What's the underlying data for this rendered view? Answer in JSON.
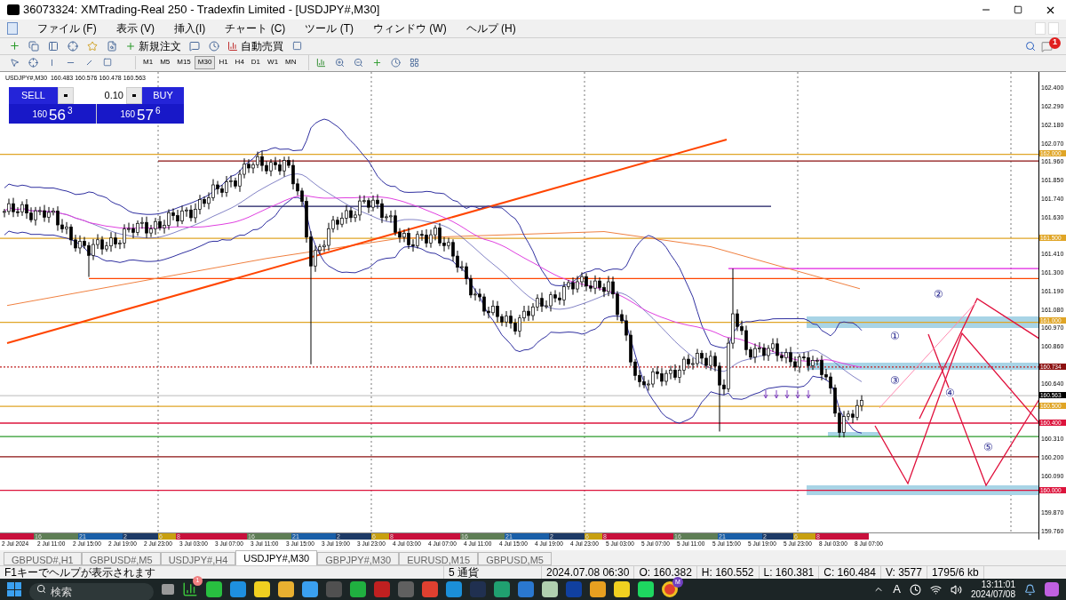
{
  "window": {
    "title": "36073324: XMTrading-Real 250 - Tradexfin Limited - [USDJPY#,M30]"
  },
  "menu": [
    "ファイル (F)",
    "表示 (V)",
    "挿入(I)",
    "チャート (C)",
    "ツール (T)",
    "ウィンドウ (W)",
    "ヘルプ (H)"
  ],
  "toolbar": {
    "new_order": "新規注文",
    "auto_trading": "自動売買",
    "notification_count": "1"
  },
  "timeframes": [
    {
      "label": "M1",
      "selected": false
    },
    {
      "label": "M5",
      "selected": false
    },
    {
      "label": "M15",
      "selected": false
    },
    {
      "label": "M30",
      "selected": true
    },
    {
      "label": "H1",
      "selected": false
    },
    {
      "label": "H4",
      "selected": false
    },
    {
      "label": "D1",
      "selected": false
    },
    {
      "label": "W1",
      "selected": false
    },
    {
      "label": "MN",
      "selected": false
    }
  ],
  "chart": {
    "header": "USDJPY#,M30  160.483 160.576 160.478 160.563",
    "trade_panel": {
      "sell": "SELL",
      "buy": "BUY",
      "lots": "0.10",
      "bid": {
        "big": "160",
        "pips": "56",
        "point": "3"
      },
      "ask": {
        "big": "160",
        "pips": "57",
        "point": "6"
      }
    },
    "annotations": [
      "②",
      "①",
      "③",
      "④",
      "⑤"
    ],
    "price_ticks": [
      "162.400",
      "162.290",
      "162.180",
      "162.070",
      "161.960",
      "161.850",
      "161.740",
      "161.630",
      "161.410",
      "161.300",
      "161.190",
      "161.080",
      "160.970",
      "160.860",
      "160.640",
      "160.310",
      "160.200",
      "160.090",
      "159.870",
      "159.760"
    ],
    "price_badges": [
      {
        "label": "162.000",
        "color": "#e0a526"
      },
      {
        "label": "161.500",
        "color": "#e0a526"
      },
      {
        "label": "161.000",
        "color": "#e0a526"
      },
      {
        "label": "160.734",
        "color": "#8b1010"
      },
      {
        "label": "160.563",
        "color": "#000000"
      },
      {
        "label": "160.500",
        "color": "#e0a526"
      },
      {
        "label": "160.400",
        "color": "#dc143c"
      },
      {
        "label": "160.000",
        "color": "#dc143c"
      }
    ],
    "sessions": [
      {
        "color": "#c8103c"
      },
      {
        "label": "16",
        "color": "#5e7d55"
      },
      {
        "label": "21",
        "color": "#1a5fa8"
      },
      {
        "label": "2",
        "color": "#1d3a66"
      },
      {
        "label": "6",
        "color": "#c8a010"
      },
      {
        "label": "8",
        "color": "#c8103c"
      },
      {
        "label": "16",
        "color": "#5e7d55"
      },
      {
        "label": "21",
        "color": "#1a5fa8"
      },
      {
        "label": "2",
        "color": "#1d3a66"
      },
      {
        "label": "6",
        "color": "#c8a010"
      },
      {
        "label": "8",
        "color": "#c8103c"
      },
      {
        "label": "16",
        "color": "#5e7d55"
      },
      {
        "label": "21",
        "color": "#1a5fa8"
      },
      {
        "label": "2",
        "color": "#1d3a66"
      },
      {
        "label": "6",
        "color": "#c8a010"
      },
      {
        "label": "8",
        "color": "#c8103c"
      },
      {
        "label": "16",
        "color": "#5e7d55"
      },
      {
        "label": "21",
        "color": "#1a5fa8"
      },
      {
        "label": "2",
        "color": "#1d3a66"
      },
      {
        "label": "6",
        "color": "#c8a010"
      },
      {
        "label": "8",
        "color": "#c8103c"
      }
    ],
    "time_labels": [
      "2 Jul 2024",
      "2 Jul 11:00",
      "2 Jul 15:00",
      "2 Jul 19:00",
      "2 Jul 23:00",
      "3 Jul 03:00",
      "3 Jul 07:00",
      "3 Jul 11:00",
      "3 Jul 15:00",
      "3 Jul 19:00",
      "3 Jul 23:00",
      "4 Jul 03:00",
      "4 Jul 07:00",
      "4 Jul 11:00",
      "4 Jul 15:00",
      "4 Jul 19:00",
      "4 Jul 23:00",
      "5 Jul 03:00",
      "5 Jul 07:00",
      "5 Jul 11:00",
      "5 Jul 15:00",
      "5 Jul 19:00",
      "5 Jul 23:00",
      "8 Jul 03:00",
      "8 Jul 07:00"
    ]
  },
  "tabs": [
    {
      "label": "GBPUSD#,H1",
      "selected": false
    },
    {
      "label": "GBPUSD#,M5",
      "selected": false
    },
    {
      "label": "USDJPY#,H4",
      "selected": false
    },
    {
      "label": "USDJPY#,M30",
      "selected": true
    },
    {
      "label": "GBPJPY#,M30",
      "selected": false
    },
    {
      "label": "EURUSD,M15",
      "selected": false
    },
    {
      "label": "GBPUSD,M5",
      "selected": false
    }
  ],
  "status_bar": [
    "F1キーでヘルプが表示されます",
    "5 通貨",
    "2024.07.08 06:30",
    "O: 160.382",
    "H: 160.552",
    "L: 160.381",
    "C: 160.484",
    "V: 3577",
    "1795/6 kb"
  ],
  "taskbar": {
    "search": {
      "placeholder": "検索"
    },
    "app_badge": "1",
    "browser_badge": "M",
    "ime": "A",
    "time": "13:11:01",
    "date": "2024/07/08"
  }
}
